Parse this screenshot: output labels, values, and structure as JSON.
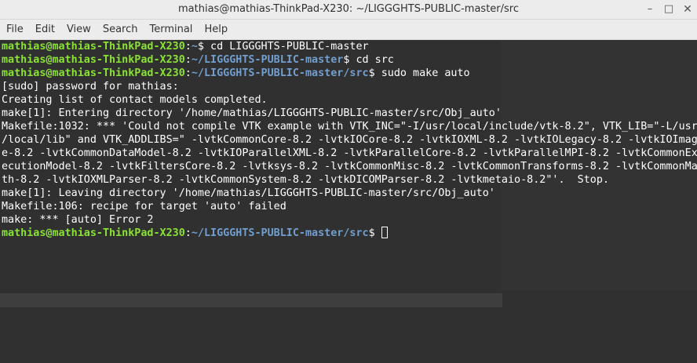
{
  "window": {
    "title": "mathias@mathias-ThinkPad-X230: ~/LIGGGHTS-PUBLIC-master/src",
    "minimize_glyph": "–",
    "maximize_glyph": "□",
    "close_glyph": "✕"
  },
  "menu": {
    "file": "File",
    "edit": "Edit",
    "view": "View",
    "search": "Search",
    "terminal": "Terminal",
    "help": "Help"
  },
  "terminal": {
    "user_host": "mathias@mathias-ThinkPad-X230",
    "colon": ":",
    "prompt1_path": "~",
    "prompt1_cmd": "$ cd LIGGGHTS-PUBLIC-master",
    "prompt2_path": "~/LIGGGHTS-PUBLIC-master",
    "prompt2_cmd": "$ cd src",
    "prompt3_path": "~/LIGGGHTS-PUBLIC-master/src",
    "prompt3_cmd": "$ sudo make auto",
    "out1": "[sudo] password for mathias:",
    "out2": "Creating list of contact models completed.",
    "out3": "make[1]: Entering directory '/home/mathias/LIGGGHTS-PUBLIC-master/src/Obj_auto'",
    "out4": "Makefile:1032: *** 'Could not compile VTK example with VTK_INC=\"-I/usr/local/include/vtk-8.2\", VTK_LIB=\"-L/usr",
    "out5": "/local/lib\" and VTK_ADDLIBS=\" -lvtkCommonCore-8.2 -lvtkIOCore-8.2 -lvtkIOXML-8.2 -lvtkIOLegacy-8.2 -lvtkIOImag",
    "out6": "e-8.2 -lvtkCommonDataModel-8.2 -lvtkIOParallelXML-8.2 -lvtkParallelCore-8.2 -lvtkParallelMPI-8.2 -lvtkCommonEx",
    "out7": "ecutionModel-8.2 -lvtkFiltersCore-8.2 -lvtksys-8.2 -lvtkCommonMisc-8.2 -lvtkCommonTransforms-8.2 -lvtkCommonMa",
    "out8": "th-8.2 -lvtkIOXMLParser-8.2 -lvtkCommonSystem-8.2 -lvtkDICOMParser-8.2 -lvtkmetaio-8.2\"'.  Stop.",
    "out9": "make[1]: Leaving directory '/home/mathias/LIGGGHTS-PUBLIC-master/src/Obj_auto'",
    "out10": "Makefile:106: recipe for target 'auto' failed",
    "out11": "make: *** [auto] Error 2",
    "prompt4_path": "~/LIGGGHTS-PUBLIC-master/src",
    "prompt4_cmd": "$ "
  },
  "colors": {
    "user_host": "#8ae234",
    "path": "#729fcf",
    "text": "#ffffff",
    "background": "#2d2d2d"
  }
}
